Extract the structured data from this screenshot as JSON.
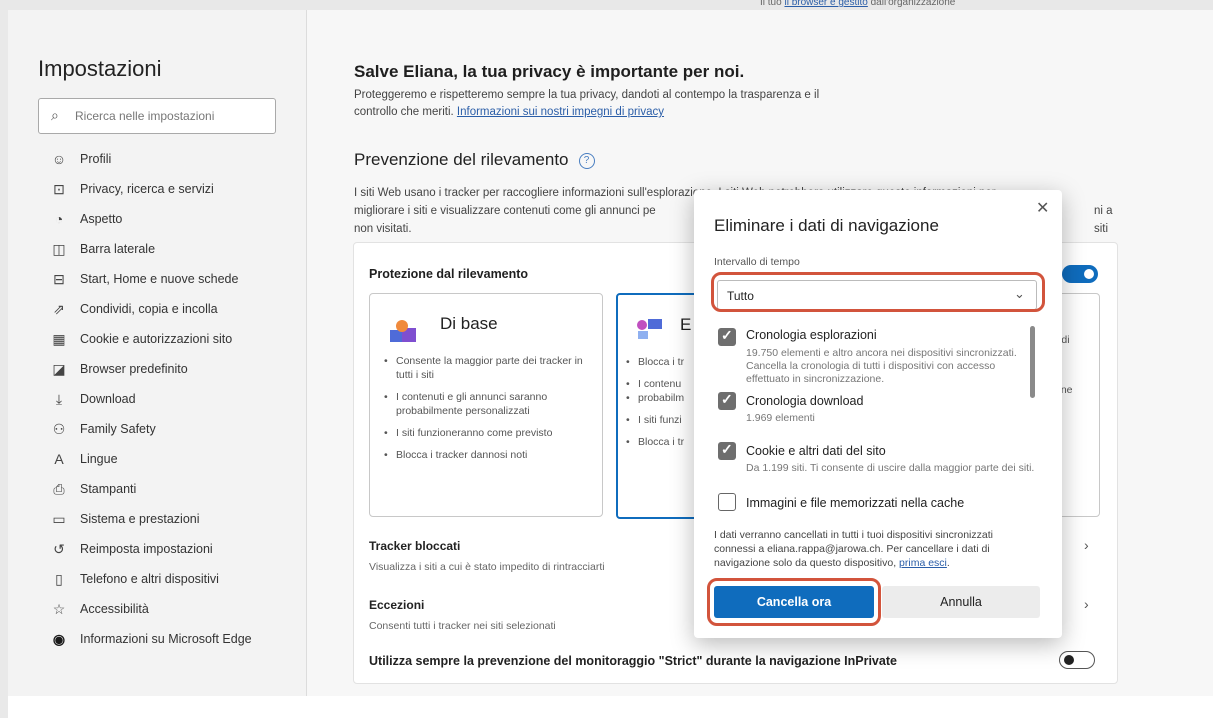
{
  "topstrip": {
    "text_prefix": "Il tuo ",
    "link": "il browser è gestito",
    "text_suffix": " dall'organizzazione"
  },
  "sidebar": {
    "title": "Impostazioni",
    "search_placeholder": "Ricerca nelle impostazioni",
    "items": [
      {
        "label": "Profili",
        "icon": "profile-icon"
      },
      {
        "label": "Privacy, ricerca e servizi",
        "icon": "lock-icon"
      },
      {
        "label": "Aspetto",
        "icon": "appearance-icon"
      },
      {
        "label": "Barra laterale",
        "icon": "sidebar-icon"
      },
      {
        "label": "Start, Home e nuove schede",
        "icon": "home-tab-icon"
      },
      {
        "label": "Condividi, copia e incolla",
        "icon": "share-icon"
      },
      {
        "label": "Cookie e autorizzazioni sito",
        "icon": "cookie-icon"
      },
      {
        "label": "Browser predefinito",
        "icon": "browser-icon"
      },
      {
        "label": "Download",
        "icon": "download-icon"
      },
      {
        "label": "Family Safety",
        "icon": "family-icon"
      },
      {
        "label": "Lingue",
        "icon": "language-icon"
      },
      {
        "label": "Stampanti",
        "icon": "printer-icon"
      },
      {
        "label": "Sistema e prestazioni",
        "icon": "system-icon"
      },
      {
        "label": "Reimposta impostazioni",
        "icon": "reset-icon"
      },
      {
        "label": "Telefono e altri dispositivi",
        "icon": "phone-icon"
      },
      {
        "label": "Accessibilità",
        "icon": "accessibility-icon"
      },
      {
        "label": "Informazioni su Microsoft Edge",
        "icon": "edge-icon"
      }
    ]
  },
  "main": {
    "greeting": "Salve Eliana, la tua privacy è importante per noi.",
    "greeting_sub": "Proteggeremo e rispetteremo sempre la tua privacy, dandoti al contempo la trasparenza e il controllo che meriti.",
    "greeting_link": "Informazioni sui nostri impegni di privacy",
    "section_title": "Prevenzione del rilevamento",
    "section_desc_1": "I siti Web usano i tracker per raccogliere informazioni sull'esplorazione. I siti Web potrebbero utilizzare queste informazioni per",
    "section_desc_2": "migliorare i siti e visualizzare contenuti come gli annunci pe",
    "section_desc_2b": "ni a siti",
    "section_desc_3": "non visitati.",
    "card_title": "Protezione dal rilevamento",
    "basic": {
      "name": "Di base",
      "bullets": [
        "Consente la maggior parte dei tracker in tutti i siti",
        "I contenuti e gli annunci saranno probabilmente personalizzati",
        "I siti funzioneranno come previsto",
        "Blocca i tracker dannosi noti"
      ]
    },
    "balanced": {
      "name": "E",
      "bullets": [
        "Blocca i tr",
        "I contenu",
        "probabilm",
        "I siti funzi",
        "Blocca i tr"
      ]
    },
    "strict_frags": [
      "r di",
      "one"
    ],
    "tracker_title": "Tracker bloccati",
    "tracker_sub": "Visualizza i siti a cui è stato impedito di rintracciarti",
    "exceptions_title": "Eccezioni",
    "exceptions_sub": "Consenti tutti i tracker nei siti selezionati",
    "inprivate_label": "Utilizza sempre la prevenzione del monitoraggio \"Strict\" durante la navigazione InPrivate"
  },
  "dialog": {
    "title": "Eliminare i dati di navigazione",
    "range_label": "Intervallo di tempo",
    "range_value": "Tutto",
    "items": [
      {
        "title": "Cronologia esplorazioni",
        "desc": "19.750 elementi e altro ancora nei dispositivi sincronizzati. Cancella la cronologia di tutti i dispositivi con accesso effettuato in sincronizzazione.",
        "checked": true
      },
      {
        "title": "Cronologia download",
        "desc": "1.969 elementi",
        "checked": true
      },
      {
        "title": "Cookie e altri dati del sito",
        "desc": "Da 1.199 siti. Ti consente di uscire dalla maggior parte dei siti.",
        "checked": true
      },
      {
        "title": "Immagini e file memorizzati nella cache",
        "desc": "",
        "checked": false
      }
    ],
    "note": "I dati verranno cancellati in tutti i tuoi dispositivi sincronizzati connessi a eliana.rappa@jarowa.ch. Per cancellare i dati di navigazione solo da questo dispositivo,",
    "note_link": "prima esci",
    "note_end": ".",
    "primary_label": "Cancella ora",
    "secondary_label": "Annulla",
    "highlight_color": "#d2543c",
    "accent_color": "#0f6cbd"
  }
}
